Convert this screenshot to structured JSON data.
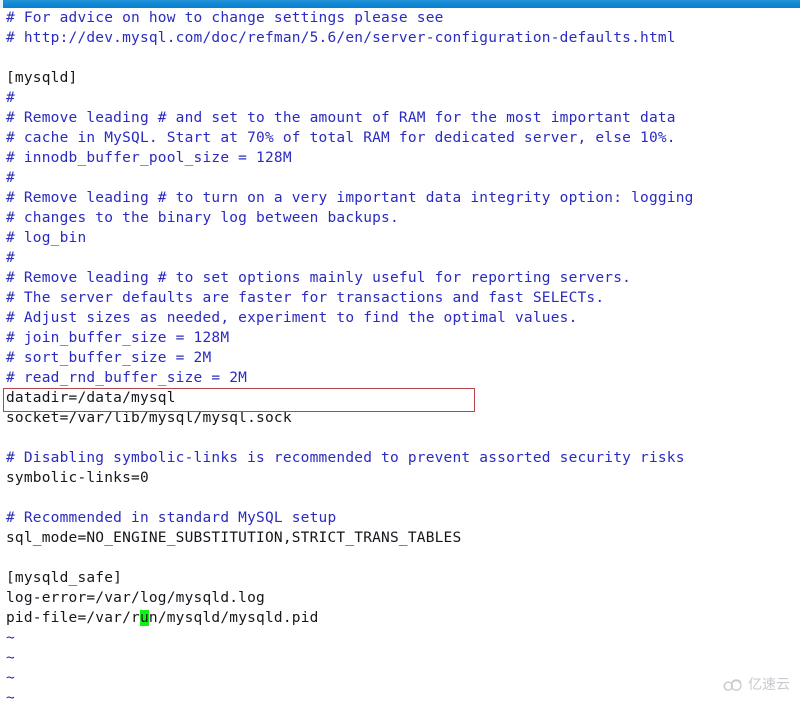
{
  "window": {
    "titlebar_color": "#0f85d4",
    "background_color": "#ffffff"
  },
  "editor": {
    "name": "vi-text-editor",
    "comment_color": "#2b2bbf",
    "code_color": "#16161c",
    "cursor_color": "#13f113",
    "highlight_box_color": "#b9454c",
    "lines": [
      {
        "text": "# For advice on how to change settings please see",
        "type": "comment"
      },
      {
        "text": "# http://dev.mysql.com/doc/refman/5.6/en/server-configuration-defaults.html",
        "type": "comment"
      },
      {
        "text": "",
        "type": "blank"
      },
      {
        "text": "[mysqld]",
        "type": "code"
      },
      {
        "text": "#",
        "type": "comment"
      },
      {
        "text": "# Remove leading # and set to the amount of RAM for the most important data",
        "type": "comment"
      },
      {
        "text": "# cache in MySQL. Start at 70% of total RAM for dedicated server, else 10%.",
        "type": "comment"
      },
      {
        "text": "# innodb_buffer_pool_size = 128M",
        "type": "comment"
      },
      {
        "text": "#",
        "type": "comment"
      },
      {
        "text": "# Remove leading # to turn on a very important data integrity option: logging",
        "type": "comment"
      },
      {
        "text": "# changes to the binary log between backups.",
        "type": "comment"
      },
      {
        "text": "# log_bin",
        "type": "comment"
      },
      {
        "text": "#",
        "type": "comment"
      },
      {
        "text": "# Remove leading # to set options mainly useful for reporting servers.",
        "type": "comment"
      },
      {
        "text": "# The server defaults are faster for transactions and fast SELECTs.",
        "type": "comment"
      },
      {
        "text": "# Adjust sizes as needed, experiment to find the optimal values.",
        "type": "comment"
      },
      {
        "text": "# join_buffer_size = 128M",
        "type": "comment"
      },
      {
        "text": "# sort_buffer_size = 2M",
        "type": "comment"
      },
      {
        "text": "# read_rnd_buffer_size = 2M",
        "type": "comment"
      },
      {
        "text": "datadir=/data/mysql",
        "type": "code",
        "highlighted": true
      },
      {
        "text": "socket=/var/lib/mysql/mysql.sock",
        "type": "code"
      },
      {
        "text": "",
        "type": "blank"
      },
      {
        "text": "# Disabling symbolic-links is recommended to prevent assorted security risks",
        "type": "comment"
      },
      {
        "text": "symbolic-links=0",
        "type": "code"
      },
      {
        "text": "",
        "type": "blank"
      },
      {
        "text": "# Recommended in standard MySQL setup",
        "type": "comment"
      },
      {
        "text": "sql_mode=NO_ENGINE_SUBSTITUTION,STRICT_TRANS_TABLES",
        "type": "code"
      },
      {
        "text": "",
        "type": "blank"
      },
      {
        "text": "[mysqld_safe]",
        "type": "code"
      },
      {
        "text": "log-error=/var/log/mysqld.log",
        "type": "code"
      },
      {
        "text": "pid-file=/var/r|u|n/mysqld/mysqld.pid",
        "type": "code",
        "cursor_line": true
      },
      {
        "text": "~",
        "type": "tilde"
      },
      {
        "text": "~",
        "type": "tilde"
      },
      {
        "text": "~",
        "type": "tilde"
      },
      {
        "text": "~",
        "type": "tilde"
      }
    ],
    "cursor": {
      "line_text_before": "pid-file=/var/r",
      "char": "u",
      "line_text_after": "n/mysqld/mysqld.pid"
    }
  },
  "watermark": {
    "text": "亿速云",
    "icon": "cloud-icon",
    "color": "#9aa0aa"
  }
}
